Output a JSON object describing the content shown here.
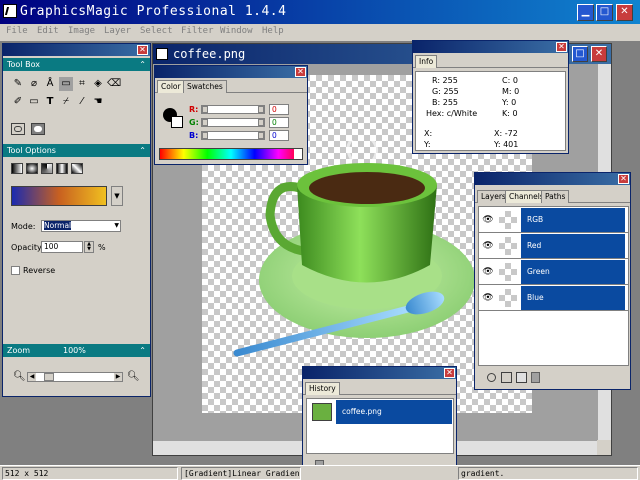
{
  "app": {
    "title": "GraphicsMagic Professional 1.4.4"
  },
  "menu": [
    "File",
    "Edit",
    "Image",
    "Layer",
    "Select",
    "Filter",
    "Window",
    "Help"
  ],
  "document": {
    "title": "coffee.png"
  },
  "toolbox": {
    "title": "Tool Box",
    "tools": [
      "✎",
      "⌀",
      "Å",
      "▭",
      "⌗",
      "◈",
      "⌫",
      "✐",
      "▭",
      "T",
      "⌿",
      "⁄",
      "☚"
    ]
  },
  "tool_options": {
    "title": "Tool Options",
    "mode_label": "Mode:",
    "mode_value": "Normal",
    "opacity_label": "Opacity:",
    "opacity_value": "100",
    "opacity_unit": "%",
    "reverse_label": "Reverse"
  },
  "zoom": {
    "title": "Zoom",
    "value": "100%"
  },
  "color_panel": {
    "tabs": [
      "Color",
      "Swatches"
    ],
    "channels": [
      {
        "label": "R:",
        "value": "0",
        "color": "#d00000"
      },
      {
        "label": "G:",
        "value": "0",
        "color": "#008000"
      },
      {
        "label": "B:",
        "value": "0",
        "color": "#0000d0"
      }
    ]
  },
  "info_panel": {
    "tab": "Info",
    "left": [
      "R: 255",
      "G: 255",
      "B: 255",
      "Hex: c/White"
    ],
    "right": [
      "C: 0",
      "M: 0",
      "Y: 0",
      "K: 0"
    ],
    "coord_left": [
      "X:",
      "Y:"
    ],
    "coord_right": [
      "X: -72",
      "Y: 401"
    ]
  },
  "layers_panel": {
    "tabs": [
      "Layers",
      "Channels",
      "Paths"
    ],
    "channels": [
      "RGB",
      "Red",
      "Green",
      "Blue"
    ]
  },
  "history_panel": {
    "tab": "History",
    "items": [
      "coffee.png"
    ]
  },
  "status": {
    "size": "512 x 512",
    "tool": "[Gradient]Linear Gradient",
    "hint": "gradient."
  },
  "colors": {
    "titlebar": "#000080",
    "section": "#0a7a82",
    "selection": "#0a4aa0"
  }
}
